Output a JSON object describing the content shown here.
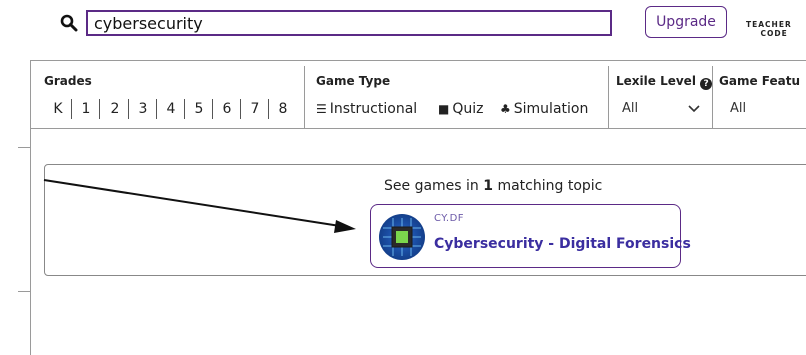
{
  "search": {
    "value": "cybersecurity"
  },
  "header": {
    "upgrade_label": "Upgrade",
    "brand_line1": "TEACHER",
    "brand_line2": "CODE"
  },
  "filters": {
    "grades_label": "Grades",
    "grades": [
      "K",
      "1",
      "2",
      "3",
      "4",
      "5",
      "6",
      "7",
      "8"
    ],
    "game_type_label": "Game Type",
    "game_types": [
      "Instructional",
      "Quiz",
      "Simulation"
    ],
    "lexile_label": "Lexile Level",
    "lexile_value": "All",
    "features_label": "Game Featu",
    "features_value": "All"
  },
  "results": {
    "heading_prefix": "See games in",
    "heading_count": "1",
    "heading_suffix": "matching topic",
    "topic": {
      "code": "CY.DF",
      "title": "Cybersecurity - Digital Forensics"
    }
  },
  "colors": {
    "accent": "#5b2a86",
    "topic_title": "#3b2ea0"
  }
}
